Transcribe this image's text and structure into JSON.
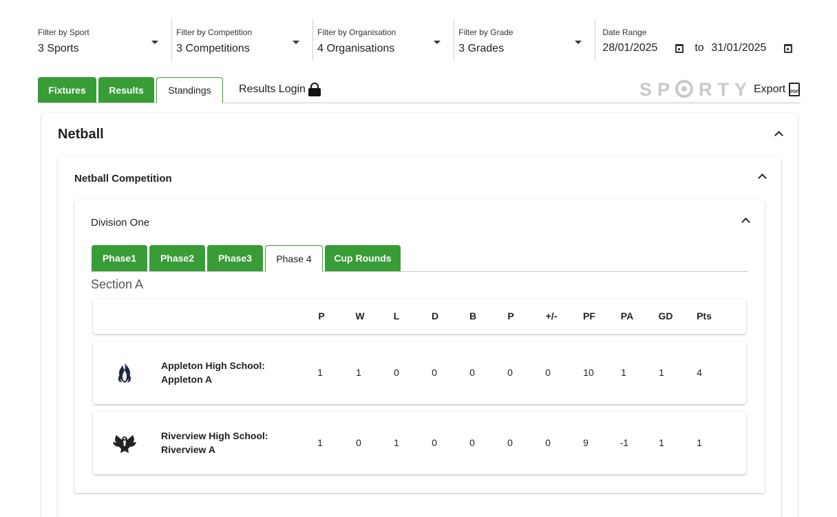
{
  "filters": {
    "sport": {
      "label": "Filter by Sport",
      "value": "3 Sports"
    },
    "competition": {
      "label": "Filter by Competition",
      "value": "3 Competitions"
    },
    "organisation": {
      "label": "Filter by Organisation",
      "value": "4 Organisations"
    },
    "grade": {
      "label": "Filter by Grade",
      "value": "3 Grades"
    },
    "date_range": {
      "label": "Date Range",
      "from": "28/01/2025",
      "to_word": "to",
      "to": "31/01/2025"
    }
  },
  "main_tabs": {
    "fixtures": "Fixtures",
    "results": "Results",
    "standings": "Standings",
    "results_login": "Results Login",
    "export": "Export",
    "logo_text": "SPORTY"
  },
  "sport": {
    "title": "Netball",
    "competition": {
      "title": "Netball Competition",
      "division": {
        "title": "Division One",
        "phase_tabs": [
          "Phase1",
          "Phase2",
          "Phase3",
          "Phase 4",
          "Cup Rounds"
        ],
        "active_phase": "Phase 4",
        "section": "Section A",
        "columns": [
          "P",
          "W",
          "L",
          "D",
          "B",
          "P",
          "+/-",
          "PF",
          "PA",
          "GD",
          "Pts"
        ],
        "rows": [
          {
            "team": "Appleton High School: Appleton A",
            "logo": "flame-crest-icon",
            "values": [
              "1",
              "1",
              "0",
              "0",
              "0",
              "0",
              "0",
              "10",
              "1",
              "1",
              "4"
            ]
          },
          {
            "team": "Riverview High School: Riverview A",
            "logo": "eagle-crest-icon",
            "values": [
              "1",
              "0",
              "1",
              "0",
              "0",
              "0",
              "0",
              "9",
              "-1",
              "1",
              "1"
            ]
          }
        ]
      }
    }
  },
  "colors": {
    "accent_green": "#389c37",
    "text": "#212121",
    "logo_grey": "#c9c9c9"
  }
}
